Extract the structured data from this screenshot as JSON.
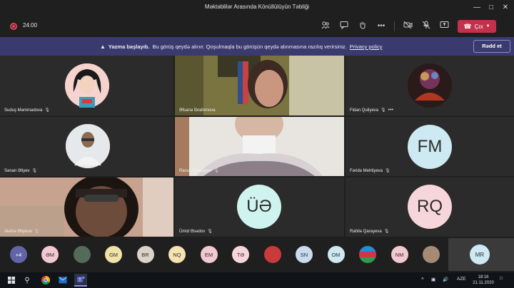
{
  "window": {
    "title": "Məktəblilər Arasında Könüllülüyün Təbliği"
  },
  "toolbar": {
    "timer": "24:00",
    "leave_label": "Çıx"
  },
  "banner": {
    "bold": "Yazma başlayıb.",
    "text": "Bu görüş qeydə alınır. Qoşulmaqla bu görüşün qeydə alınmasına razılıq verirsiniz.",
    "privacy": "Privacy policy",
    "dismiss": "Rədd et"
  },
  "tiles": [
    {
      "name": "Suduş Məmmədova",
      "kind": "avatar-illustration"
    },
    {
      "name": "Əfsanə İbrahimova",
      "kind": "video"
    },
    {
      "name": "Fidan Quliyeva",
      "kind": "avatar-photo"
    },
    {
      "name": "Sənan Əliyev",
      "kind": "avatar-photo"
    },
    {
      "name": "Rasul Ağakişiyev",
      "kind": "video"
    },
    {
      "name": "Fəridə Mehtiyeva",
      "kind": "initials",
      "initials": "FM",
      "color": "#cde9f2"
    },
    {
      "name": "Aləmə Əliyeva",
      "kind": "video"
    },
    {
      "name": "Ümid Əsədov",
      "kind": "initials",
      "initials": "ÜƏ",
      "color": "#cff3ee"
    },
    {
      "name": "Rahilə Qarayeva",
      "kind": "initials",
      "initials": "RQ",
      "color": "#f7d6db"
    }
  ],
  "participants_bar": {
    "overflow": "+4",
    "chips": [
      {
        "initials": "ƏM",
        "color": "#f3c9d1"
      },
      {
        "initials": "",
        "color": "#556b5a",
        "kind": "photo"
      },
      {
        "initials": "GM",
        "color": "#f0e2a8"
      },
      {
        "initials": "BR",
        "color": "#dad3c8"
      },
      {
        "initials": "NQ",
        "color": "#f7e2b1"
      },
      {
        "initials": "EM",
        "color": "#f3c9d1"
      },
      {
        "initials": "TƏ",
        "color": "#f7d6db"
      },
      {
        "initials": "",
        "color": "#c93a3a",
        "kind": "photo"
      },
      {
        "initials": "SN",
        "color": "#c9dcef"
      },
      {
        "initials": "OM",
        "color": "#cde9f2"
      },
      {
        "initials": "",
        "color": "#2f6fbd",
        "kind": "flag"
      },
      {
        "initials": "NM",
        "color": "#f3c9d1"
      },
      {
        "initials": "",
        "color": "#a58b76",
        "kind": "photo"
      }
    ],
    "self": {
      "initials": "MR",
      "color": "#cde9f2"
    }
  },
  "taskbar": {
    "lang": "AZE",
    "time": "18:16",
    "date": "21.11.2020"
  }
}
